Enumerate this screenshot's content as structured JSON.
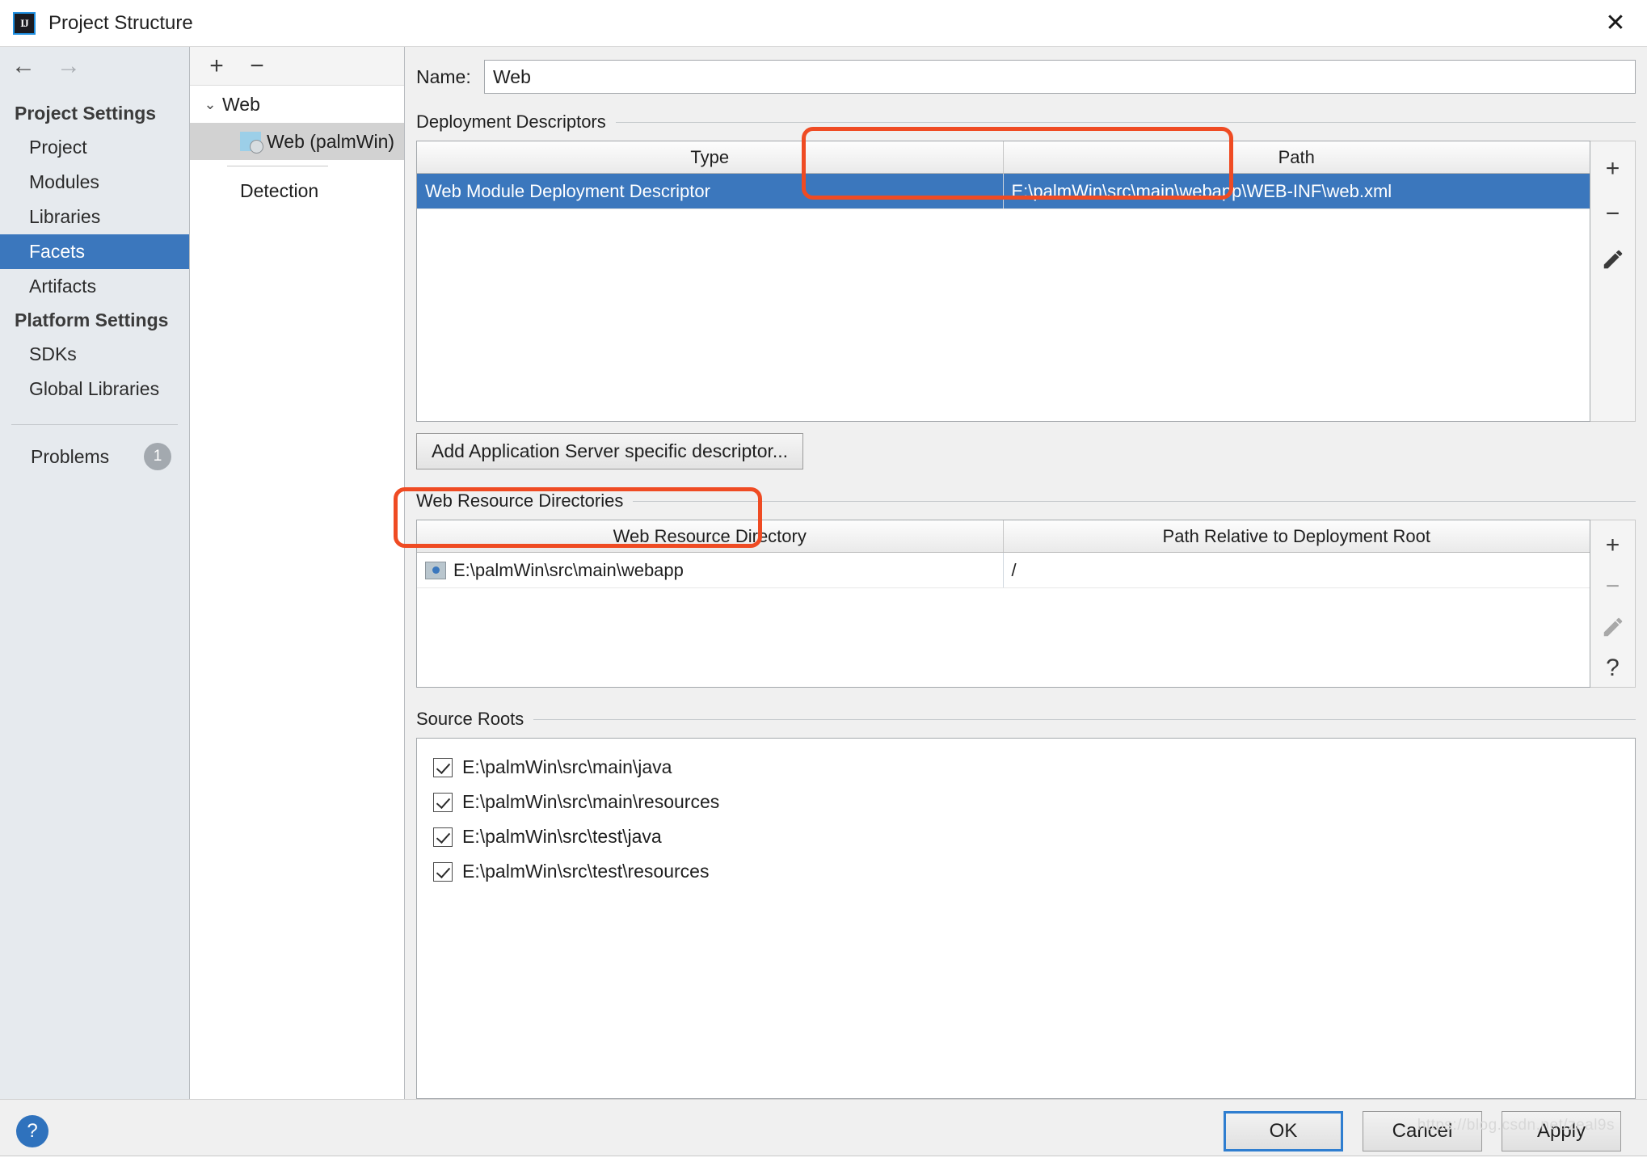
{
  "window": {
    "title": "Project Structure",
    "app_icon": "IJ",
    "close_icon": "✕"
  },
  "nav": {
    "back_icon": "←",
    "forward_icon": "→"
  },
  "sidebar": {
    "groups": [
      {
        "header": "Project Settings",
        "items": [
          {
            "label": "Project",
            "selected": false
          },
          {
            "label": "Modules",
            "selected": false
          },
          {
            "label": "Libraries",
            "selected": false
          },
          {
            "label": "Facets",
            "selected": true
          },
          {
            "label": "Artifacts",
            "selected": false
          }
        ]
      },
      {
        "header": "Platform Settings",
        "items": [
          {
            "label": "SDKs",
            "selected": false
          },
          {
            "label": "Global Libraries",
            "selected": false
          }
        ]
      }
    ],
    "problems": {
      "label": "Problems",
      "count": "1"
    }
  },
  "tree": {
    "toolbar": {
      "add_icon": "+",
      "remove_icon": "−"
    },
    "root": {
      "label": "Web",
      "chevron": "⌄"
    },
    "child": {
      "label": "Web (palmWin)",
      "selected": true
    },
    "detection": {
      "label": "Detection"
    }
  },
  "main": {
    "name_field": {
      "label": "Name:",
      "value": "Web",
      "placeholder": ""
    },
    "deployment_descriptors": {
      "section_label": "Deployment Descriptors",
      "columns": [
        "Type",
        "Path"
      ],
      "rows": [
        {
          "type": "Web Module Deployment Descriptor",
          "path": "E:\\palmWin\\src\\main\\webapp\\WEB-INF\\web.xml",
          "selected": true
        }
      ],
      "toolbar": [
        "add-icon",
        "remove-icon",
        "edit-icon"
      ],
      "add_label": "+",
      "remove_label": "−"
    },
    "add_server_descriptor_button": "Add Application Server specific descriptor...",
    "web_resource_directories": {
      "section_label": "Web Resource Directories",
      "columns": [
        "Web Resource Directory",
        "Path Relative to Deployment Root"
      ],
      "rows": [
        {
          "directory": "E:\\palmWin\\src\\main\\webapp",
          "relative_path": "/"
        }
      ],
      "add_label": "+",
      "remove_label": "−",
      "help_label": "?"
    },
    "source_roots": {
      "section_label": "Source Roots",
      "items": [
        {
          "label": "E:\\palmWin\\src\\main\\java",
          "checked": true
        },
        {
          "label": "E:\\palmWin\\src\\main\\resources",
          "checked": true
        },
        {
          "label": "E:\\palmWin\\src\\test\\java",
          "checked": true
        },
        {
          "label": "E:\\palmWin\\src\\test\\resources",
          "checked": true
        }
      ]
    }
  },
  "footer": {
    "help_icon": "?",
    "ok": "OK",
    "cancel": "Cancel",
    "apply": "Apply"
  },
  "watermark": "https://blog.csdn.net/zeal9s",
  "colors": {
    "selection_blue": "#3b77bd",
    "annotation_red": "#ef4b23",
    "sidebar_bg": "#e6eaee",
    "dialog_bg": "#f0f0f0"
  }
}
